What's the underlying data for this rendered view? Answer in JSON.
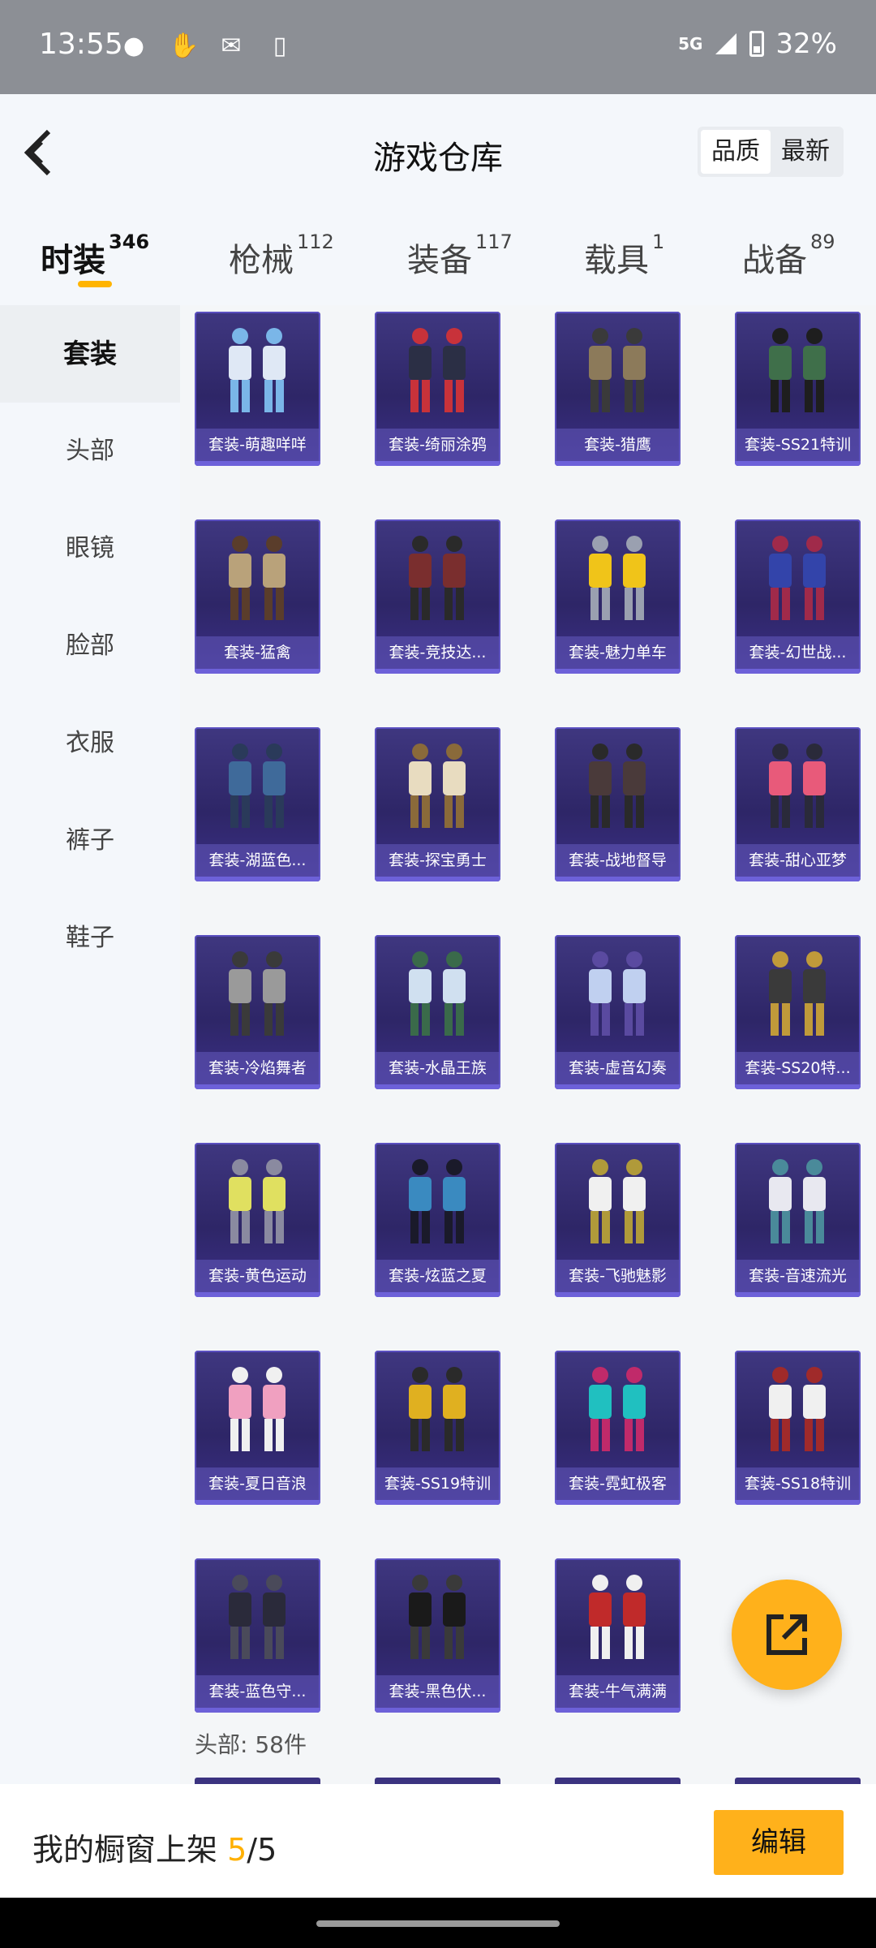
{
  "status": {
    "time": "13:55",
    "network": "5G",
    "battery": "32%"
  },
  "header": {
    "title": "游戏仓库",
    "sort_options": [
      "品质",
      "最新"
    ],
    "sort_active": 0
  },
  "tabs": [
    {
      "label": "时装",
      "count": "346"
    },
    {
      "label": "枪械",
      "count": "112"
    },
    {
      "label": "装备",
      "count": "117"
    },
    {
      "label": "载具",
      "count": "1"
    },
    {
      "label": "战备",
      "count": "89"
    }
  ],
  "sidebar": [
    "套装",
    "头部",
    "眼镜",
    "脸部",
    "衣服",
    "裤子",
    "鞋子"
  ],
  "items": [
    "套装-萌趣咩咩",
    "套装-绮丽涂鸦",
    "套装-猎鹰",
    "套装-SS21特训",
    "套装-猛禽",
    "套装-竞技达...",
    "套装-魅力单车",
    "套装-幻世战...",
    "套装-湖蓝色...",
    "套装-探宝勇士",
    "套装-战地督导",
    "套装-甜心亚梦",
    "套装-冷焰舞者",
    "套装-水晶王族",
    "套装-虚音幻奏",
    "套装-SS20特...",
    "套装-黄色运动",
    "套装-炫蓝之夏",
    "套装-飞驰魅影",
    "套装-音速流光",
    "套装-夏日音浪",
    "套装-SS19特训",
    "套装-霓虹极客",
    "套装-SS18特训",
    "套装-蓝色守...",
    "套装-黑色伏...",
    "套装-牛气满满"
  ],
  "section_next": "头部: 58件",
  "showcase": {
    "label": "我的橱窗上架",
    "current": "5",
    "total": "/5"
  },
  "edit_label": "编辑",
  "colors": {
    "accent": "#ffb11b",
    "card_bg": "#2e2667",
    "card_border": "#5a4fc0"
  }
}
